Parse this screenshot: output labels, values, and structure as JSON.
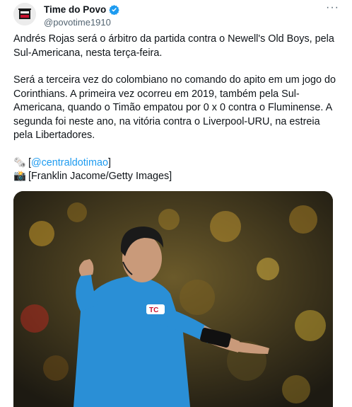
{
  "author": {
    "name": "Time do Povo",
    "handle": "@povotime1910"
  },
  "menu_icon": "more-dots-icon",
  "text": {
    "p1": "Andrés Rojas será o árbitro da partida contra o Newell's Old Boys, pela Sul-Americana, nesta terça-feira.",
    "p2": "Será a terceira vez do colombiano no comando do apito em um jogo do Corinthians. A primeira vez ocorreu em 2019, também pela Sul-Americana, quando o Timão empatou por 0 x 0 contra o Fluminense. A segunda foi neste ano, na vitória contra o Liverpool-URU, na estreia pela Libertadores.",
    "credit1_emoji": "🗞️",
    "credit1_open": "[",
    "credit1_link": "@centraldotimao",
    "credit1_close": "]",
    "credit2_emoji": "📸",
    "credit2": "[Franklin Jacome/Getty Images]"
  },
  "photo": {
    "subject": "referee in blue shirt pointing arm, stadium crowd background",
    "shirt_text": "TC"
  },
  "colors": {
    "link": "#1d9bf0",
    "verified": "#1d9bf0",
    "shirt": "#2a8fd6"
  }
}
